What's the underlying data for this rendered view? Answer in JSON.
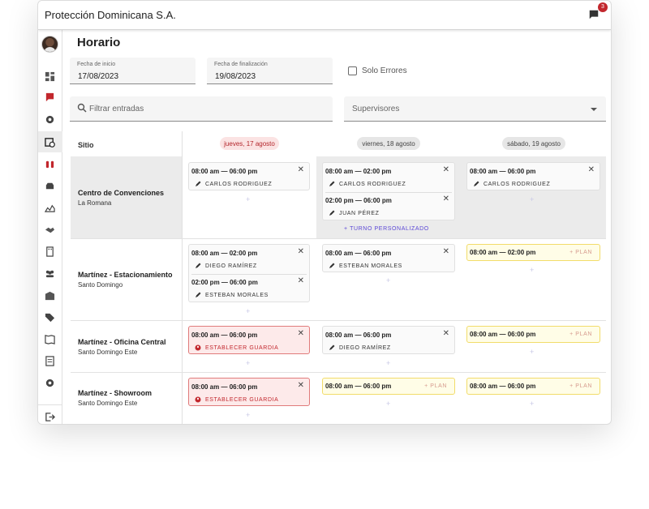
{
  "app": {
    "title": "Protección Dominicana S.A.",
    "notifications": "3"
  },
  "page": {
    "title": "Horario"
  },
  "filters": {
    "start_label": "Fecha de inicio",
    "start_value": "17/08/2023",
    "end_label": "Fecha de finalización",
    "end_value": "19/08/2023",
    "errors_label": "Solo Errores",
    "search_placeholder": "Filtrar entradas",
    "supervisors_placeholder": "Supervisores"
  },
  "grid": {
    "site_header": "Sitio",
    "days": [
      {
        "label": "jueves, 17 agosto",
        "state": "today"
      },
      {
        "label": "viernes, 18 agosto",
        "state": "normal"
      },
      {
        "label": "sábado, 19 agosto",
        "state": "normal"
      }
    ],
    "sites": [
      {
        "name": "Centro de Convenciones",
        "city": "La Romana"
      },
      {
        "name": "Martínez - Estacionamiento",
        "city": "Santo Domingo"
      },
      {
        "name": "Martínez - Oficina Central",
        "city": "Santo Domingo Este"
      },
      {
        "name": "Martínez - Showroom",
        "city": "Santo Domingo Este"
      }
    ],
    "custom_shift_label": "+ TURNO PERSONALIZADO",
    "plan_label": "+ PLAN",
    "assign_guard_label": "ESTABLECER GUARDIA",
    "add_symbol": "+",
    "close_symbol": "✕",
    "shifts": {
      "r0c0": [
        {
          "time": "08:00 am — 06:00 pm",
          "guard": "CARLOS RODRIGUEZ"
        }
      ],
      "r0c1": [
        {
          "time": "08:00 am — 02:00 pm",
          "guard": "CARLOS RODRIGUEZ"
        },
        {
          "time": "02:00 pm — 06:00 pm",
          "guard": "JUAN PÉREZ"
        }
      ],
      "r0c2": [
        {
          "time": "08:00 am — 06:00 pm",
          "guard": "CARLOS RODRIGUEZ"
        }
      ],
      "r1c0": [
        {
          "time": "08:00 am — 02:00 pm",
          "guard": "DIEGO RAMÍREZ"
        },
        {
          "time": "02:00 pm — 06:00 pm",
          "guard": "ESTEBAN MORALES"
        }
      ],
      "r1c1": [
        {
          "time": "08:00 am — 06:00 pm",
          "guard": "ESTEBAN MORALES"
        }
      ],
      "r1c2": [
        {
          "time": "08:00 am — 02:00 pm",
          "status": "plan"
        }
      ],
      "r2c0": [
        {
          "time": "08:00 am — 06:00 pm",
          "status": "unassigned"
        }
      ],
      "r2c1": [
        {
          "time": "08:00 am — 06:00 pm",
          "guard": "DIEGO RAMÍREZ"
        }
      ],
      "r2c2": [
        {
          "time": "08:00 am — 06:00 pm",
          "status": "plan"
        }
      ],
      "r3c0": [
        {
          "time": "08:00 am — 06:00 pm",
          "status": "unassigned"
        }
      ],
      "r3c1": [
        {
          "time": "08:00 am — 06:00 pm",
          "status": "plan"
        }
      ],
      "r3c2": [
        {
          "time": "08:00 am — 06:00 pm",
          "status": "plan"
        }
      ]
    }
  },
  "nav_icons": [
    "dashboard-icon",
    "flag-alert-icon",
    "badge-icon",
    "calendar-clock-icon",
    "binoculars-icon",
    "car-shield-icon",
    "chart-area-icon",
    "handshake-icon",
    "building-icon",
    "team-icon",
    "warehouse-icon",
    "tags-icon",
    "map-icon",
    "report-icon",
    "settings-icon",
    "logout-icon"
  ],
  "colors": {
    "accent": "#c2272d",
    "purple": "#5b47d6",
    "plan_yellow": "#fffde7",
    "error_red": "#fdeaea"
  }
}
